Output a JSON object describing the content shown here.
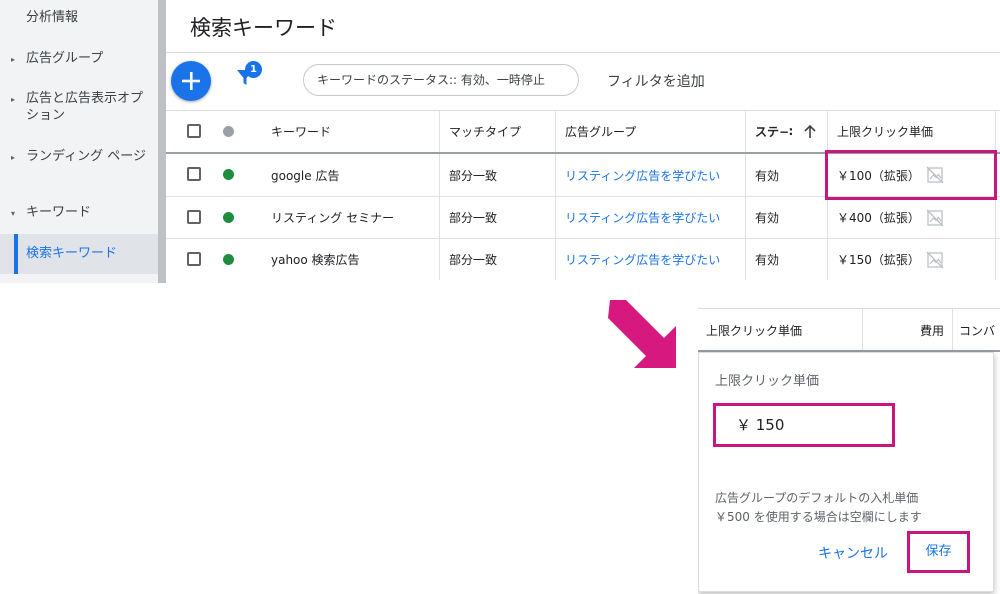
{
  "sidebar": {
    "items": [
      {
        "label": "分析情報",
        "arrow": ""
      },
      {
        "label": "広告グループ",
        "arrow": "▸"
      },
      {
        "label": "広告と広告表示オプション",
        "arrow": "▸"
      },
      {
        "label": "ランディング ページ",
        "arrow": "▸"
      },
      {
        "label": "キーワード",
        "arrow": "▾"
      },
      {
        "label": "検索キーワード",
        "arrow": ""
      }
    ]
  },
  "main": {
    "title": "検索キーワード",
    "filter_badge": "1",
    "status_chip": "キーワードのステータス:: 有効、一時停止",
    "add_filter": "フィルタを追加"
  },
  "table": {
    "headers": {
      "keyword": "キーワード",
      "match_type": "マッチタイプ",
      "ad_group": "広告グループ",
      "status": "ステ−∶",
      "sort_icon": "arrow-up-icon",
      "max_cpc": "上限クリック単価"
    },
    "rows": [
      {
        "keyword": "google 広告",
        "match_type": "部分一致",
        "ad_group": "リスティング広告を学びたい",
        "status": "有効",
        "max_cpc": "￥100（拡張）"
      },
      {
        "keyword": "リスティング セミナー",
        "match_type": "部分一致",
        "ad_group": "リスティング広告を学びたい",
        "status": "有効",
        "max_cpc": "￥400（拡張）"
      },
      {
        "keyword": "yahoo 検索広告",
        "match_type": "部分一致",
        "ad_group": "リスティング広告を学びたい",
        "status": "有効",
        "max_cpc": "￥150（拡張）"
      }
    ]
  },
  "editor": {
    "header_max_cpc": "上限クリック単価",
    "header_cost": "費用",
    "header_conv": "コンバ",
    "label": "上限クリック単価",
    "value": "￥ 150",
    "help_line1": "広告グループのデフォルトの入札単価",
    "help_line2": "￥500 を使用する場合は空欄にします",
    "cancel": "キャンセル",
    "save": "保存"
  },
  "colors": {
    "accent": "#1a73e8",
    "highlight": "#c8167e",
    "status_enabled": "#1e8e3e",
    "header_dot": "#9aa0a6"
  }
}
